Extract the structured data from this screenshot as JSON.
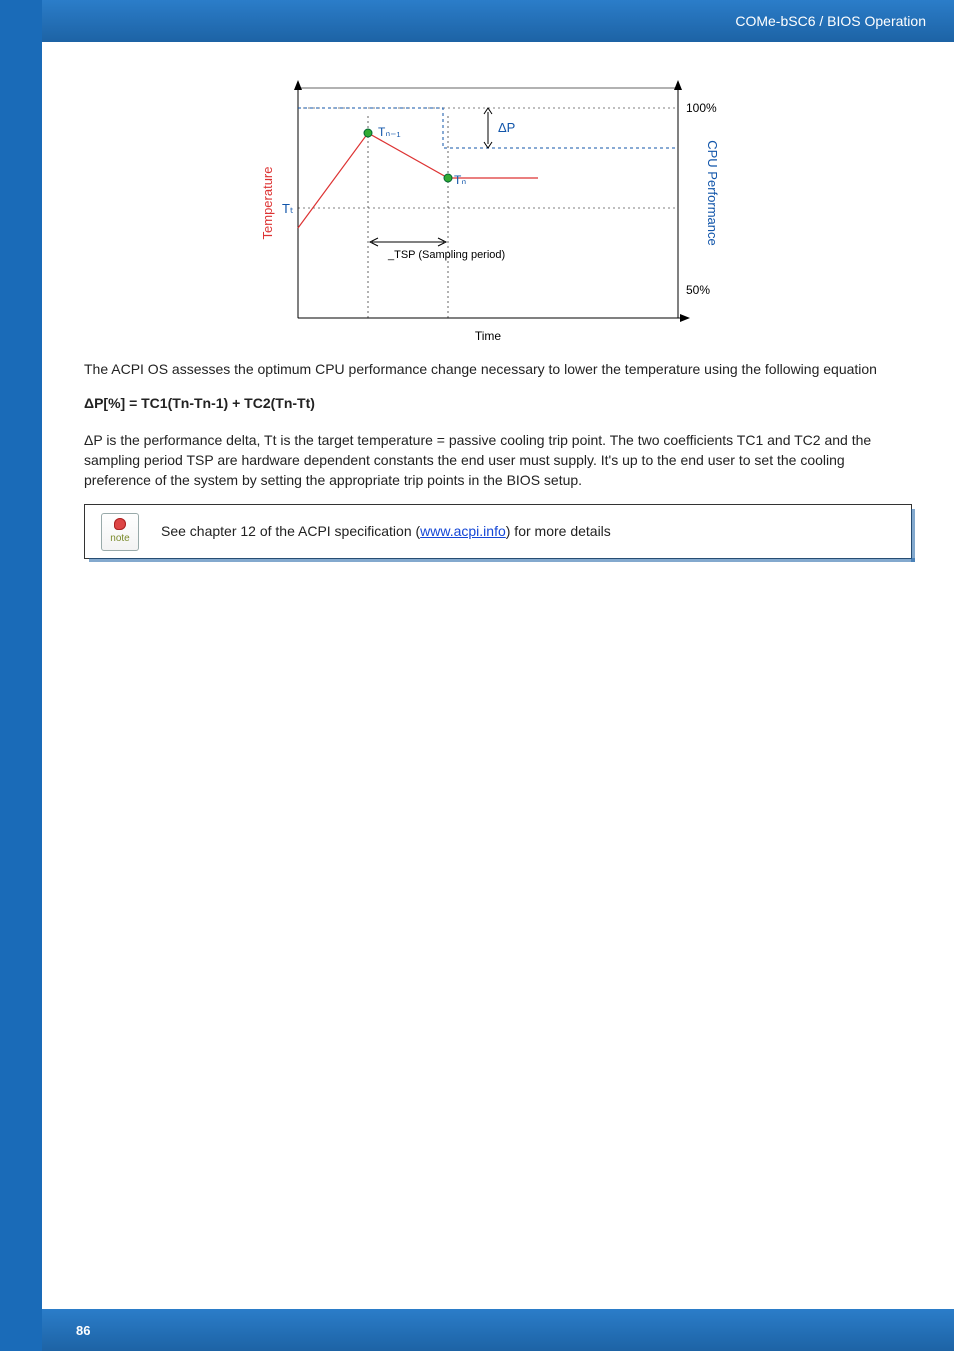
{
  "header": {
    "breadcrumb": "COMe-bSC6 / BIOS Operation"
  },
  "footer": {
    "page_number": "86"
  },
  "body": {
    "para1": "The ACPI OS assesses the optimum CPU performance change necessary to lower the temperature using the following equation",
    "formula": "ΔP[%] = TC1(Tn-Tn-1) + TC2(Tn-Tt)",
    "para2_a": "ΔP is the performance delta, Tt is the target temperature = passive cooling trip point. The two coefficients TC1 and TC2 and the sampling period TSP are hardware dependent constants the end user must supply. It's up to the end user to set the cooling preference of the system by setting the appropriate trip points in the BIOS setup.",
    "note_pre": "See chapter 12 of the ACPI specification (",
    "note_link": "www.acpi.info",
    "note_post": ") for more details",
    "note_icon_label": "note"
  },
  "chart_data": {
    "type": "line",
    "title": "",
    "x_axis_label": "Time",
    "y_left_label": "Temperature",
    "y_right_label": "CPU Performance",
    "y_left_tick": "Tₜ",
    "y_right_ticks": [
      "100%",
      "50%"
    ],
    "annotations": {
      "delta_p": "ΔP",
      "tsp": "_TSP (Sampling period)",
      "point_prev": "Tₙ₋₁",
      "point_curr": "Tₙ"
    },
    "series": [
      {
        "name": "Temperature",
        "color": "#d33",
        "x": [
          0,
          1,
          2,
          3
        ],
        "y_rel": [
          0.42,
          0.74,
          0.55,
          0.55
        ]
      },
      {
        "name": "CPU Performance step",
        "color": "#15a",
        "x": [
          0,
          1.5,
          1.5,
          4
        ],
        "y_pct": [
          100,
          100,
          85,
          85
        ]
      }
    ],
    "xlim": [
      0,
      4
    ],
    "perf_ylim_pct": [
      50,
      100
    ]
  }
}
